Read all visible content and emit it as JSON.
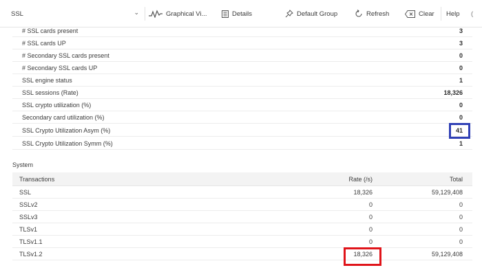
{
  "toolbar": {
    "select_value": "SSL",
    "graphical_view": "Graphical Vi...",
    "details": "Details",
    "default_group": "Default Group",
    "refresh": "Refresh",
    "clear": "Clear",
    "help": "Help"
  },
  "ssl_stats": [
    {
      "label": "# SSL cards present",
      "value": "3"
    },
    {
      "label": "# SSL cards UP",
      "value": "3"
    },
    {
      "label": "# Secondary SSL cards present",
      "value": "0"
    },
    {
      "label": "# Secondary SSL cards UP",
      "value": "0"
    },
    {
      "label": "SSL engine status",
      "value": "1"
    },
    {
      "label": "SSL sessions (Rate)",
      "value": "18,326"
    },
    {
      "label": "SSL crypto utilization (%)",
      "value": "0"
    },
    {
      "label": "Secondary card utilization (%)",
      "value": "0"
    },
    {
      "label": "SSL Crypto Utilization Asym (%)",
      "value": "41"
    },
    {
      "label": "SSL Crypto Utilization Symm (%)",
      "value": "1"
    }
  ],
  "system": {
    "title": "System",
    "columns": [
      "Transactions",
      "Rate (/s)",
      "Total"
    ],
    "rows": [
      [
        "SSL",
        "18,326",
        "59,129,408"
      ],
      [
        "SSLv2",
        "0",
        "0"
      ],
      [
        "SSLv3",
        "0",
        "0"
      ],
      [
        "TLSv1",
        "0",
        "0"
      ],
      [
        "TLSv1.1",
        "0",
        "0"
      ],
      [
        "TLSv1.2",
        "18,326",
        "59,129,408"
      ]
    ]
  },
  "colors": {
    "highlight_blue": "#2f3fb5",
    "highlight_red": "#e0141a"
  }
}
